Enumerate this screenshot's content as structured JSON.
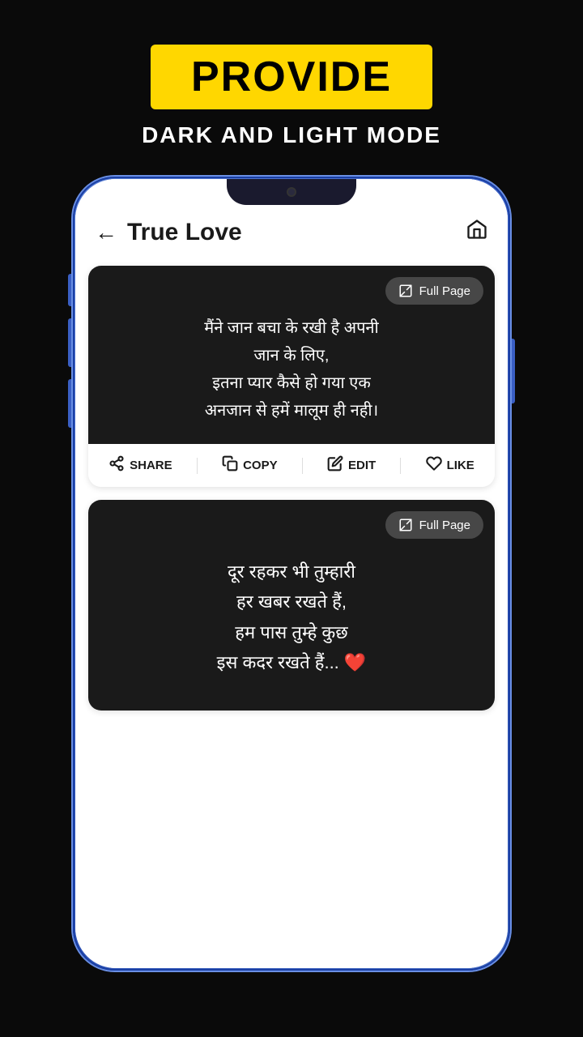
{
  "header": {
    "badge_text": "PROVIDE",
    "subtitle": "DARK AND LIGHT MODE"
  },
  "app": {
    "title": "True Love",
    "back_label": "←",
    "home_icon": "⌂",
    "full_page_label": "Full Page"
  },
  "cards": [
    {
      "id": "card1",
      "text": "मैंने जान बचा के रखी है अपनी\nजान के लिए,\nइतना प्यार कैसे हो गया एक\nअनजान से हमें मालूम ही नही।",
      "actions": [
        {
          "id": "share",
          "icon": "share",
          "label": "SHARE"
        },
        {
          "id": "copy",
          "icon": "copy",
          "label": "COPY"
        },
        {
          "id": "edit",
          "icon": "edit",
          "label": "EDIT"
        },
        {
          "id": "like",
          "icon": "like",
          "label": "LIKE"
        }
      ]
    },
    {
      "id": "card2",
      "text": "दूर रहकर भी तुम्हारी\nहर खबर रखते हैं,\nहम पास तुम्हे कुछ\nइस कदर रखते हैं... ❤️"
    }
  ],
  "colors": {
    "background": "#0a0a0a",
    "badge_bg": "#FFD700",
    "badge_text": "#000000",
    "card_dark": "#1a1a1a",
    "card_text": "#ffffff",
    "accent": "#FFD700"
  }
}
